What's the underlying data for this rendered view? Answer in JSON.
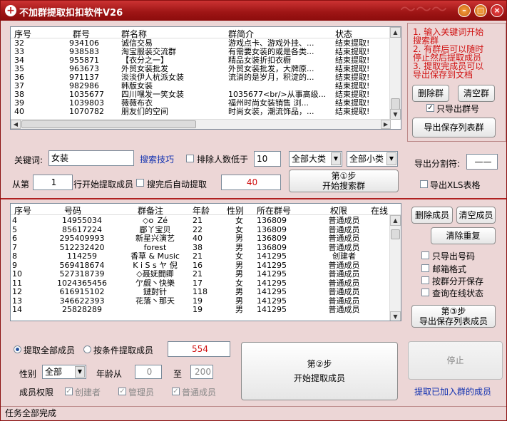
{
  "window": {
    "title": "不加群提取扣扣软件V26",
    "minimize_icon": "minimize-icon",
    "maximize_icon": "maximize-icon",
    "close_icon": "close-icon"
  },
  "groups_table": {
    "columns": [
      "序号",
      "群号",
      "群名称",
      "群简介",
      "状态"
    ],
    "rows": [
      [
        "32",
        "934106",
        "诚信交易",
        "游戏点卡、游戏外挂、...",
        "结束提取!"
      ],
      [
        "33",
        "938583",
        "淘宝服装交流群",
        "有需要女装的或是各类...",
        "结束提取!"
      ],
      [
        "34",
        "955871",
        "【衣分之一】",
        "精品女装折扣衣橱",
        "结束提取!"
      ],
      [
        "35",
        "963673",
        "外贸女装批发",
        "外贸女装批发，大牌原...",
        "结束提取!"
      ],
      [
        "36",
        "971137",
        "淡淡伊人杭派女装",
        "流淌的是岁月，积淀的...",
        "结束提取!"
      ],
      [
        "37",
        "982986",
        "韩版女装",
        "",
        "结束提取!"
      ],
      [
        "38",
        "1035677",
        "四川嘿发一笑女装",
        "1035677<br/>从事高级...",
        "结束提取!"
      ],
      [
        "39",
        "1039803",
        "薇薇布衣",
        "福州时尚女装销售 浏...",
        "结束提取!"
      ],
      [
        "40",
        "1070782",
        "朋友们的空间",
        "时尚女装，潮流饰品，...",
        "结束提取!"
      ]
    ]
  },
  "instructions": [
    "1. 输入关键词开始",
    "搜索群",
    "2. 有群后可以随时",
    "停止然后提取成员",
    "3. 提取完成员可以",
    "导出保存到文档"
  ],
  "group_actions": {
    "delete_group": "删除群",
    "clear_group": "清空群",
    "export_only_numbers": "只导出群号",
    "export_only_numbers_checked": true,
    "export_save_group_list": "导出保存列表群"
  },
  "search": {
    "keyword_label": "关键词:",
    "keyword_value": "女装",
    "search_tips_link": "搜索技巧",
    "exclude_members_label": "排除人数低于",
    "exclude_members_checked": false,
    "exclude_members_value": "10",
    "category_main": "全部大类",
    "category_sub": "全部小类",
    "from_label": "从第",
    "from_value": "1",
    "from_suffix": "行开始提取成员",
    "auto_extract_label": "搜完后自动提取",
    "auto_extract_checked": false,
    "group_count": "40",
    "start_search_line1": "第①步",
    "start_search_line2": "开始搜索群"
  },
  "export_opts": {
    "separator_label": "导出分割符:",
    "separator_value": "——",
    "xls_label": "导出XLS表格",
    "xls_checked": false
  },
  "members_table": {
    "columns": [
      "序号",
      "号码",
      "群备注",
      "年龄",
      "性别",
      "所在群号",
      "权限",
      "在线"
    ],
    "rows": [
      [
        "4",
        "14955034",
        "◇o_Zé",
        "21",
        "女",
        "136809",
        "普通成员",
        ""
      ],
      [
        "5",
        "85617224",
        "郿丫宝贝",
        "22",
        "女",
        "136809",
        "普通成员",
        ""
      ],
      [
        "6",
        "295409993",
        "新星兴演艺",
        "40",
        "男",
        "136809",
        "普通成员",
        ""
      ],
      [
        "7",
        "512232420",
        "forest",
        "38",
        "男",
        "136809",
        "普通成员",
        ""
      ],
      [
        "8",
        "114259",
        "香草 & Music",
        "21",
        "女",
        "141295",
        "创建者",
        ""
      ],
      [
        "9",
        "569418674",
        "K i S s ヤ 倪",
        "16",
        "男",
        "141295",
        "普通成员",
        ""
      ],
      [
        "10",
        "527318739",
        "◇聂妩闘卿",
        "21",
        "男",
        "141295",
        "普通成员",
        ""
      ],
      [
        "11",
        "1024365456",
        "亇觑丶快樂",
        "17",
        "女",
        "141295",
        "普通成员",
        ""
      ],
      [
        "12",
        "616915102",
        "鏈尌针",
        "118",
        "男",
        "141295",
        "普通成员",
        ""
      ],
      [
        "13",
        "346622393",
        "花落丶那天",
        "19",
        "男",
        "141295",
        "普通成员",
        ""
      ],
      [
        "14",
        "25828289",
        "",
        "19",
        "男",
        "141295",
        "普通成员",
        ""
      ]
    ]
  },
  "member_actions": {
    "delete_member": "删除成员",
    "clear_member": "清空成员",
    "clear_duplicates": "清除重复",
    "export_only_number": "只导出号码",
    "email_format": "邮箱格式",
    "save_by_group": "按群分开保存",
    "query_online": "查询在线状态",
    "export_members_line1": "第③步",
    "export_members_line2": "导出保存列表成员"
  },
  "extract": {
    "all_members_label": "提取全部成员",
    "all_members_selected": true,
    "conditional_label": "按条件提取成员",
    "conditional_selected": false,
    "member_count": "554",
    "gender_label": "性别",
    "gender_value": "全部",
    "age_from_label": "年龄从",
    "age_from_value": "0",
    "age_to_label": "至",
    "age_to_value": "200",
    "permission_label": "成员权限",
    "perm_creator": "创建者",
    "perm_admin": "管理员",
    "perm_normal": "普通成员",
    "start_line1": "第②步",
    "start_line2": "开始提取成员",
    "stop_label": "停止",
    "extract_joined": "提取已加入群的成员"
  },
  "status_bar": {
    "text": "任务全部完成"
  }
}
